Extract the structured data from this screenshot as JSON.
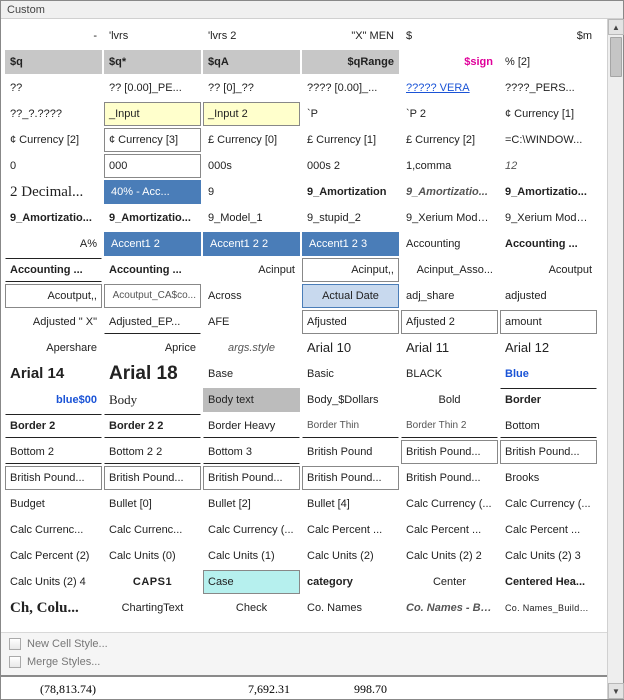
{
  "title": "Custom",
  "footer": {
    "new_cell_style": "New Cell Style...",
    "merge_styles": "Merge Styles..."
  },
  "bottom_values": [
    "(78,813.74)",
    "",
    "7,692.31",
    "998.70",
    "",
    ""
  ],
  "cells": [
    {
      "t": "-",
      "cls": "right"
    },
    {
      "t": "'lvrs"
    },
    {
      "t": "'lvrs 2"
    },
    {
      "t": "\"X\" MEN",
      "cls": "right"
    },
    {
      "t": "$"
    },
    {
      "t": "$m",
      "cls": "right"
    },
    {
      "t": "$q",
      "cls": "hdr-grey"
    },
    {
      "t": "$q*",
      "cls": "hdr-grey"
    },
    {
      "t": "$qA",
      "cls": "hdr-grey"
    },
    {
      "t": "$qRange",
      "cls": "hdr-grey right"
    },
    {
      "t": "$sign",
      "cls": "pink right"
    },
    {
      "t": "% [2]"
    },
    {
      "t": "??"
    },
    {
      "t": "?? [0.00]_PE..."
    },
    {
      "t": "?? [0]_??"
    },
    {
      "t": "???? [0.00]_..."
    },
    {
      "t": "????? VERA",
      "cls": "blue-underline"
    },
    {
      "t": "????_PERS..."
    },
    {
      "t": "??_?.????"
    },
    {
      "t": "_Input",
      "cls": "yellow"
    },
    {
      "t": "_Input 2",
      "cls": "yellow"
    },
    {
      "t": "`P"
    },
    {
      "t": "`P 2"
    },
    {
      "t": "¢ Currency [1]"
    },
    {
      "t": "¢ Currency [2]"
    },
    {
      "t": "¢ Currency [3]",
      "cls": "boxed"
    },
    {
      "t": "£ Currency [0]"
    },
    {
      "t": "£ Currency [1]"
    },
    {
      "t": "£ Currency [2]"
    },
    {
      "t": "=C:\\WINDOW..."
    },
    {
      "t": "0"
    },
    {
      "t": "000",
      "cls": "boxed"
    },
    {
      "t": "000s"
    },
    {
      "t": "000s 2"
    },
    {
      "t": "1,comma"
    },
    {
      "t": "12",
      "cls": "italic"
    },
    {
      "t": "2 Decimal...",
      "cls": "serif-big"
    },
    {
      "t": "40% - Acc...",
      "cls": "sel-blue"
    },
    {
      "t": "9"
    },
    {
      "t": "9_Amortization",
      "cls": "bold"
    },
    {
      "t": "9_Amortizatio...",
      "cls": "bold italic"
    },
    {
      "t": "9_Amortizatio...",
      "cls": "bold"
    },
    {
      "t": "9_Amortizatio...",
      "cls": "bold"
    },
    {
      "t": "9_Amortizatio...",
      "cls": "bold"
    },
    {
      "t": "9_Model_1"
    },
    {
      "t": "9_stupid_2"
    },
    {
      "t": "9_Xerium Model ..."
    },
    {
      "t": "9_Xerium Model ..."
    },
    {
      "t": "A%",
      "cls": "right"
    },
    {
      "t": "Accent1 2",
      "cls": "sel-blue"
    },
    {
      "t": "Accent1 2 2",
      "cls": "sel-blue"
    },
    {
      "t": "Accent1 2 3",
      "cls": "sel-blue"
    },
    {
      "t": "Accounting"
    },
    {
      "t": "Accounting ...",
      "cls": "bold"
    },
    {
      "t": "Accounting ...",
      "cls": "bold under over"
    },
    {
      "t": "Accounting ...",
      "cls": "bold"
    },
    {
      "t": "Acinput",
      "cls": "right"
    },
    {
      "t": "Acinput,,",
      "cls": "right boxed"
    },
    {
      "t": "Acinput_Asso...",
      "cls": "right"
    },
    {
      "t": "Acoutput",
      "cls": "right"
    },
    {
      "t": "Acoutput,,",
      "cls": "right boxed"
    },
    {
      "t": "Acoutput_CA$co...",
      "cls": "right boxed thin"
    },
    {
      "t": "Across"
    },
    {
      "t": "Actual Date",
      "cls": "sel-but"
    },
    {
      "t": "adj_share"
    },
    {
      "t": "adjusted"
    },
    {
      "t": "Adjusted \" X\"",
      "cls": "right"
    },
    {
      "t": "Adjusted_EP...",
      "cls": "under"
    },
    {
      "t": "AFE"
    },
    {
      "t": "Afjusted",
      "cls": "boxed"
    },
    {
      "t": "Afjusted 2",
      "cls": "boxed"
    },
    {
      "t": "amount",
      "cls": "boxed"
    },
    {
      "t": "Apershare",
      "cls": "right"
    },
    {
      "t": "Aprice",
      "cls": "right"
    },
    {
      "t": "args.style",
      "cls": "italic center"
    },
    {
      "t": "Arial 10",
      "cls": "arial-lg"
    },
    {
      "t": "Arial 11",
      "cls": "arial-lg"
    },
    {
      "t": "Arial 12",
      "cls": "arial-lg"
    },
    {
      "t": "Arial 14",
      "cls": "arial-big"
    },
    {
      "t": "Arial 18",
      "cls": "arial-huge"
    },
    {
      "t": "Base"
    },
    {
      "t": "Basic"
    },
    {
      "t": "BLACK"
    },
    {
      "t": "Blue",
      "cls": "blue"
    },
    {
      "t": "blue$00",
      "cls": "blue right"
    },
    {
      "t": "Body",
      "cls": "body-lbl"
    },
    {
      "t": "Body text",
      "cls": "grey-fill"
    },
    {
      "t": "Body_$Dollars"
    },
    {
      "t": "Bold",
      "cls": "center"
    },
    {
      "t": "Border",
      "cls": "bold over"
    },
    {
      "t": "Border 2",
      "cls": "bold over under"
    },
    {
      "t": "Border 2 2",
      "cls": "bold over under"
    },
    {
      "t": "Border Heavy",
      "cls": "under"
    },
    {
      "t": "Border Thin",
      "cls": "under thin"
    },
    {
      "t": "Border Thin 2",
      "cls": "under thin"
    },
    {
      "t": "Bottom",
      "cls": "under"
    },
    {
      "t": "Bottom 2",
      "cls": "under"
    },
    {
      "t": "Bottom 2 2",
      "cls": "under"
    },
    {
      "t": "Bottom 3",
      "cls": "under"
    },
    {
      "t": "British Pound"
    },
    {
      "t": "British Pound...",
      "cls": "boxed"
    },
    {
      "t": "British Pound...",
      "cls": "boxed"
    },
    {
      "t": "British Pound...",
      "cls": "boxed"
    },
    {
      "t": "British Pound...",
      "cls": "boxed"
    },
    {
      "t": "British Pound...",
      "cls": "boxed"
    },
    {
      "t": "British Pound...",
      "cls": "boxed"
    },
    {
      "t": "British Pound..."
    },
    {
      "t": "Brooks"
    },
    {
      "t": "Budget"
    },
    {
      "t": "Bullet [0]"
    },
    {
      "t": "Bullet [2]"
    },
    {
      "t": "Bullet [4]"
    },
    {
      "t": "Calc Currency (..."
    },
    {
      "t": "Calc Currency (..."
    },
    {
      "t": "Calc Currenc..."
    },
    {
      "t": "Calc Currenc..."
    },
    {
      "t": "Calc Currency (..."
    },
    {
      "t": "Calc Percent ..."
    },
    {
      "t": "Calc Percent ..."
    },
    {
      "t": "Calc Percent ..."
    },
    {
      "t": "Calc Percent (2)"
    },
    {
      "t": "Calc Units (0)"
    },
    {
      "t": "Calc Units (1)"
    },
    {
      "t": "Calc Units (2)"
    },
    {
      "t": "Calc Units (2) 2"
    },
    {
      "t": "Calc Units (2) 3"
    },
    {
      "t": "Calc Units (2) 4"
    },
    {
      "t": "CAPS1",
      "cls": "sc center"
    },
    {
      "t": "Case",
      "cls": "sel-cyan"
    },
    {
      "t": "category",
      "cls": "bold"
    },
    {
      "t": "Center",
      "cls": "center"
    },
    {
      "t": "Centered Hea...",
      "cls": "bold"
    },
    {
      "t": "Ch, Colu...",
      "cls": "serif-bold"
    },
    {
      "t": "ChartingText",
      "cls": "center"
    },
    {
      "t": "Check",
      "cls": "center"
    },
    {
      "t": "Co. Names"
    },
    {
      "t": "Co. Names - Bo...",
      "cls": "bold italic"
    },
    {
      "t": "Co. Names_Buildup...",
      "cls": "smallcaps-txt"
    }
  ]
}
